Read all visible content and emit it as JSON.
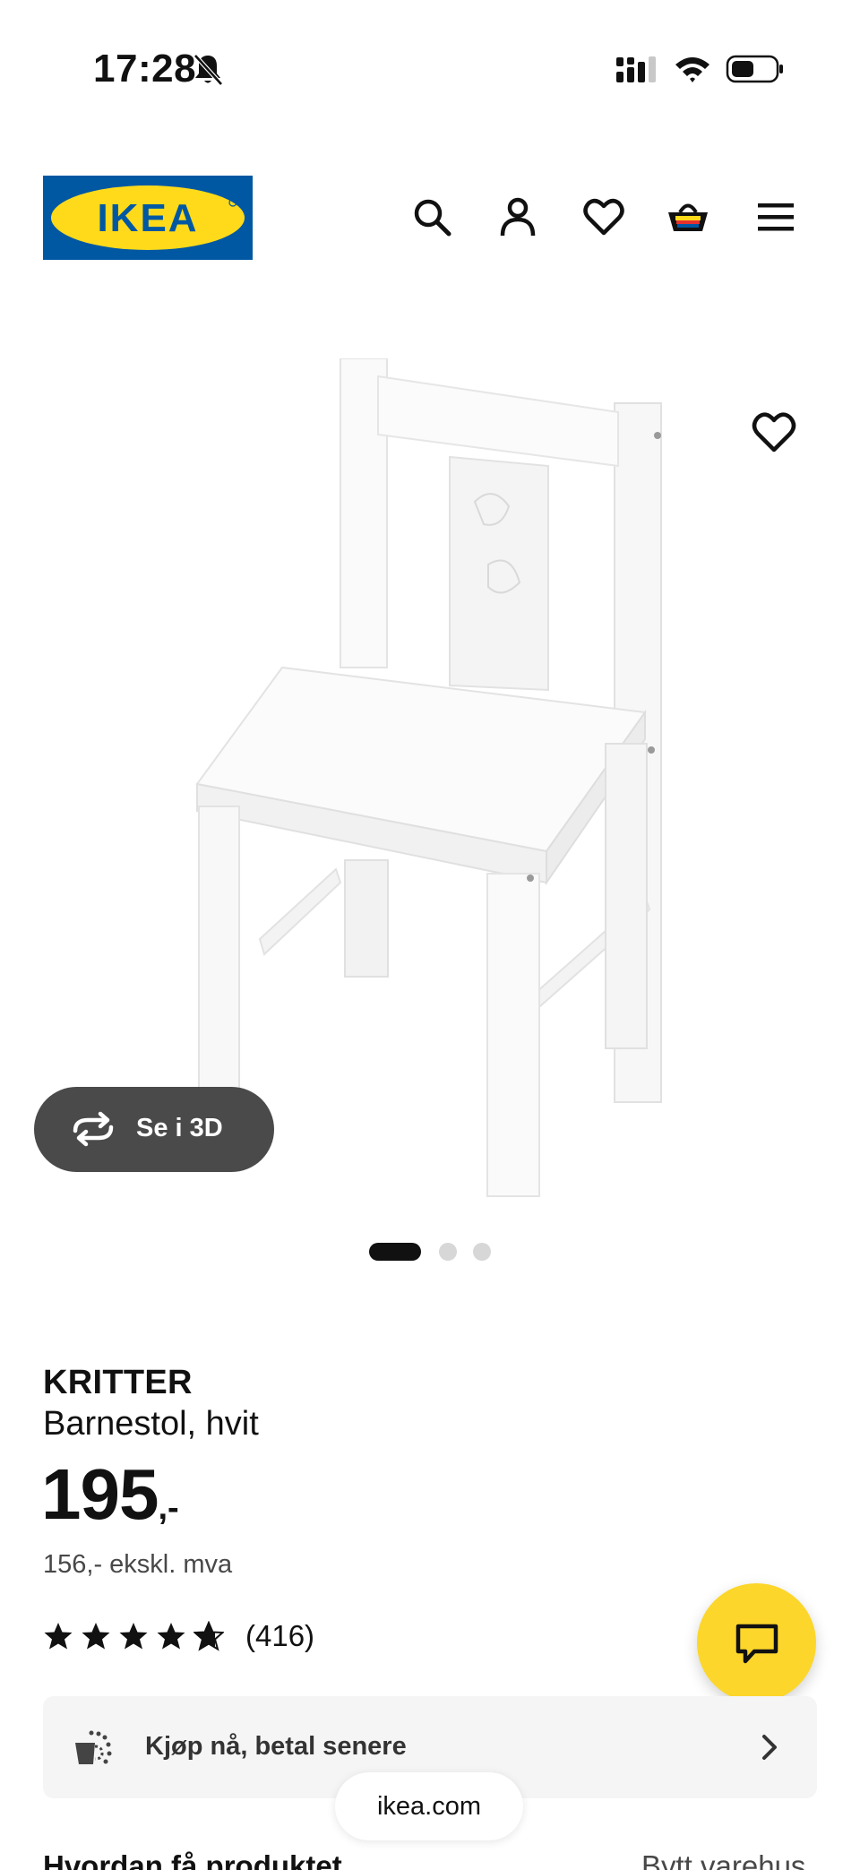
{
  "status_bar": {
    "time": "17:28",
    "icons": [
      "bell-slash-icon",
      "cellular-signal-icon",
      "wifi-icon",
      "battery-icon"
    ]
  },
  "header": {
    "logo_text": "IKEA",
    "logo_colors": {
      "blue": "#0058a3",
      "yellow": "#ffda1a"
    },
    "icons": [
      "search-icon",
      "account-icon",
      "heart-icon",
      "cart-icon",
      "menu-icon"
    ]
  },
  "gallery": {
    "view_3d_label": "Se i 3D",
    "slide_count": 3,
    "active_slide": 1,
    "favorite_icon": "heart-icon"
  },
  "product": {
    "name": "KRITTER",
    "description": "Barnestol, hvit",
    "price": "195",
    "price_suffix": ",-",
    "price_ex_vat": "156,- ekskl. mva",
    "rating": 4.7,
    "rating_max": 5,
    "review_count": "(416)"
  },
  "bnpl": {
    "label": "Kjøp nå, betal senere",
    "icon": "pay-later-icon"
  },
  "browser": {
    "url": "ikea.com"
  },
  "delivery": {
    "title": "Hvordan få produktet",
    "store_link": "Bytt varehus"
  },
  "accent_colors": {
    "chat": "#fcd62a",
    "dark_pill": "#4a4a4a"
  }
}
